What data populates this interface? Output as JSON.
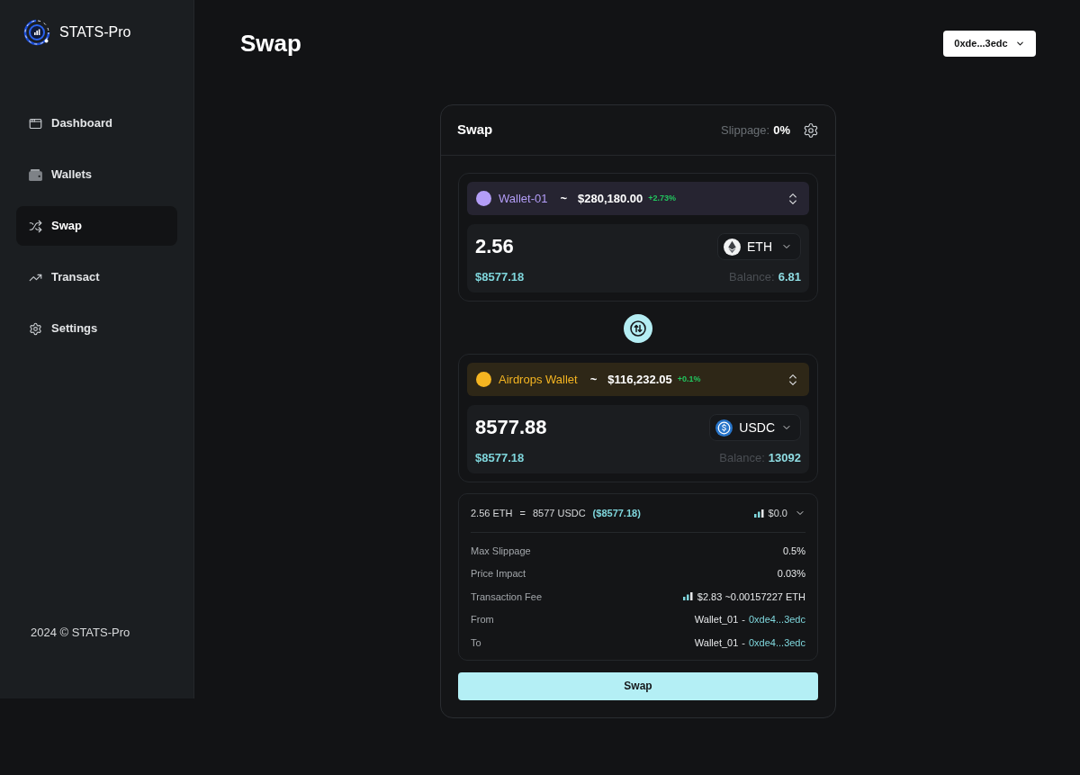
{
  "sidebar": {
    "brand": "STATS-Pro",
    "items": [
      {
        "label": "Dashboard",
        "kind": "dashboard",
        "selected": false
      },
      {
        "label": "Wallets",
        "kind": "wallets",
        "selected": false
      },
      {
        "label": "Swap",
        "kind": "swap",
        "selected": true
      },
      {
        "label": "Transact",
        "kind": "transact",
        "selected": false
      },
      {
        "label": "Settings",
        "kind": "settings",
        "selected": false
      }
    ],
    "footer": "2024 © STATS-Pro"
  },
  "header": {
    "title": "Swap",
    "wallet_button": "0xde...3edc"
  },
  "swap_card": {
    "title": "Swap",
    "slippage_label": "Slippage:",
    "slippage_value": "0%",
    "panels": [
      {
        "wallet": {
          "name": "Wallet-01",
          "color": "#b39df7",
          "separator": "~",
          "total": "$280,180.00",
          "change": "+2.73%"
        },
        "amount": "2.56",
        "usd_value": "$8577.18",
        "token": {
          "symbol": "ETH",
          "kind": "eth"
        },
        "balance_label": "Balance:",
        "balance": "6.81"
      },
      {
        "wallet": {
          "name": "Airdrops Wallet",
          "color": "#f5b521",
          "separator": "~",
          "total": "$116,232.05",
          "change": "+0.1%"
        },
        "amount": "8577.88",
        "usd_value": "$8577.18",
        "token": {
          "symbol": "USDC",
          "kind": "usdc"
        },
        "balance_label": "Balance:",
        "balance": "13092"
      }
    ],
    "summary": {
      "from": "2.56 ETH",
      "equals": "=",
      "to": "8577 USDC",
      "usd": "($8577.18)",
      "gas": "$0.0"
    },
    "details": [
      {
        "kind": "text",
        "label": "Max Slippage",
        "value": "0.5%"
      },
      {
        "kind": "text",
        "label": "Price Impact",
        "value": "0.03%"
      },
      {
        "kind": "fee",
        "label": "Transaction Fee",
        "value": "$2.83 ~0.00157227 ETH"
      },
      {
        "kind": "wallet",
        "label": "From",
        "wallet": "Wallet_01",
        "separator": "-",
        "address": "0xde4...3edc"
      },
      {
        "kind": "wallet",
        "label": "To",
        "wallet": "Wallet_01",
        "separator": "-",
        "address": "0xde4...3edc"
      }
    ],
    "button": "Swap"
  }
}
